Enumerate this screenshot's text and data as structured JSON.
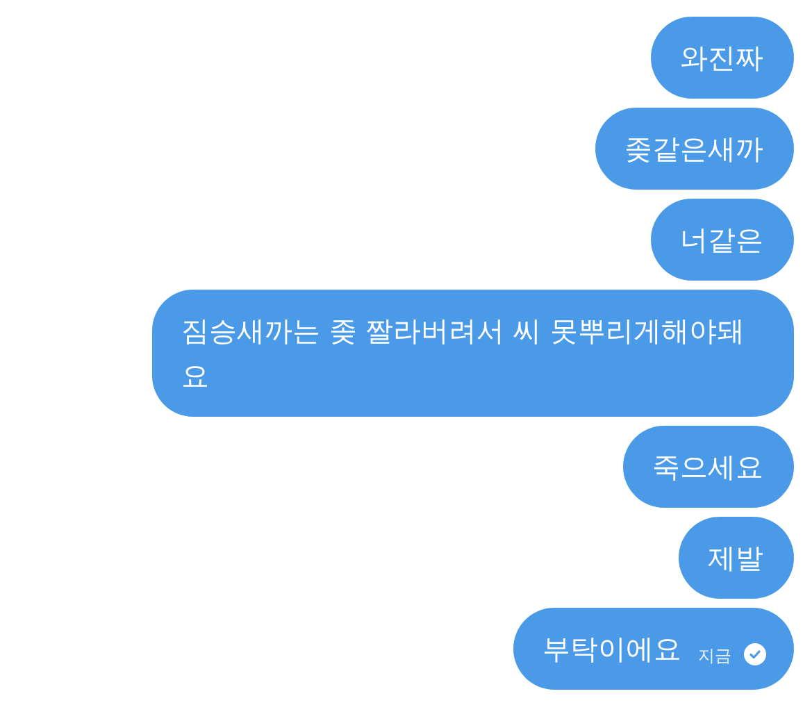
{
  "messages": [
    {
      "text": "와진짜"
    },
    {
      "text": "좆같은새까"
    },
    {
      "text": "너같은"
    },
    {
      "text": "짐승새까는 좆 짤라버려서 씨 못뿌리게해야돼요"
    },
    {
      "text": "죽으세요"
    },
    {
      "text": "제발"
    },
    {
      "text": "부탁이에요",
      "time": "지금",
      "read": true
    }
  ]
}
